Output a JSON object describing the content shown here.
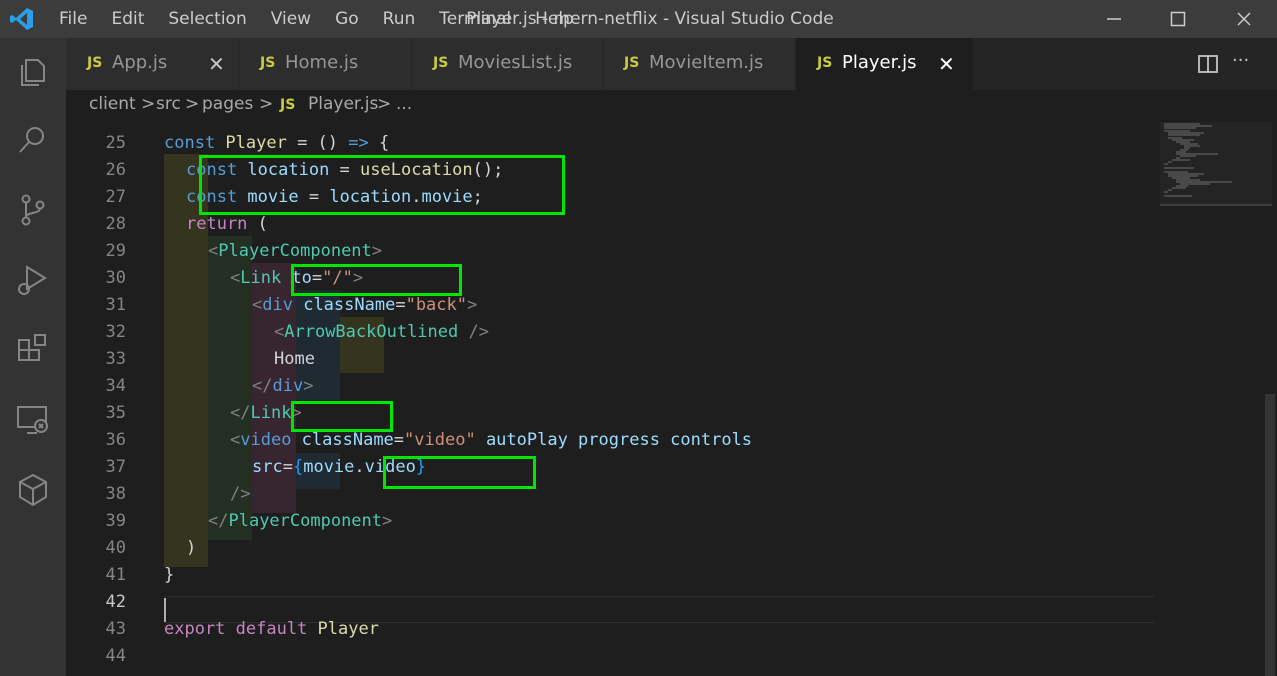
{
  "window": {
    "title": "Player.js - mern-netflix - Visual Studio Code",
    "menu": [
      "File",
      "Edit",
      "Selection",
      "View",
      "Go",
      "Run",
      "Terminal",
      "Help"
    ],
    "controls": {
      "minimize": "─",
      "maximize": "☐",
      "close": "✕"
    }
  },
  "activity_bar": [
    {
      "name": "explorer-icon"
    },
    {
      "name": "search-icon"
    },
    {
      "name": "source-control-icon"
    },
    {
      "name": "run-debug-icon"
    },
    {
      "name": "extensions-icon"
    },
    {
      "name": "remote-explorer-icon"
    },
    {
      "name": "docker-icon"
    }
  ],
  "tabs": [
    {
      "badge": "JS",
      "label": "App.js",
      "close": "✕",
      "active": false
    },
    {
      "badge": "JS",
      "label": "Home.js",
      "active": false
    },
    {
      "badge": "JS",
      "label": "MoviesList.js",
      "active": false
    },
    {
      "badge": "JS",
      "label": "MovieItem.js",
      "active": false
    },
    {
      "badge": "JS",
      "label": "Player.js",
      "close": "✕",
      "active": true
    }
  ],
  "tab_actions": {
    "more": "···"
  },
  "breadcrumb": {
    "items": [
      "client",
      "src",
      "pages",
      "Player.js",
      "..."
    ],
    "sep": ">",
    "badge": "JS"
  },
  "editor": {
    "line_numbers": [
      "25",
      "26",
      "27",
      "28",
      "29",
      "30",
      "31",
      "32",
      "33",
      "34",
      "35",
      "36",
      "37",
      "38",
      "39",
      "40",
      "41",
      "42",
      "43",
      "44"
    ],
    "current_line": "42",
    "lines": [
      [
        [
          "const ",
          "kw"
        ],
        [
          "Player",
          "fn"
        ],
        [
          " = () ",
          "op"
        ],
        [
          "=>",
          "arrow"
        ],
        [
          " {",
          "op"
        ]
      ],
      [
        [
          "const ",
          "kw"
        ],
        [
          "location",
          "var"
        ],
        [
          " = ",
          "op"
        ],
        [
          "useLocation",
          "fn"
        ],
        [
          "();",
          "op"
        ]
      ],
      [
        [
          "const ",
          "kw"
        ],
        [
          "movie",
          "var"
        ],
        [
          " = ",
          "op"
        ],
        [
          "location",
          "var"
        ],
        [
          ".",
          "op"
        ],
        [
          "movie",
          "var"
        ],
        [
          ";",
          "op"
        ]
      ],
      [
        [
          "return",
          "ctl"
        ],
        [
          " (",
          "op"
        ]
      ],
      [
        [
          "<",
          "punc"
        ],
        [
          "PlayerComponent",
          "tag"
        ],
        [
          ">",
          "punc"
        ]
      ],
      [
        [
          "<",
          "punc"
        ],
        [
          "Link ",
          "tag"
        ],
        [
          "to",
          "var"
        ],
        [
          "=",
          "op"
        ],
        [
          "\"/\"",
          "str"
        ],
        [
          ">",
          "punc"
        ]
      ],
      [
        [
          "<",
          "punc"
        ],
        [
          "div ",
          "kw"
        ],
        [
          "className",
          "var"
        ],
        [
          "=",
          "op"
        ],
        [
          "\"back\"",
          "str"
        ],
        [
          ">",
          "punc"
        ]
      ],
      [
        [
          "<",
          "punc"
        ],
        [
          "ArrowBackOutlined ",
          "tag"
        ],
        [
          "/>",
          "punc"
        ]
      ],
      [
        [
          "Home",
          "def"
        ]
      ],
      [
        [
          "</",
          "punc"
        ],
        [
          "div",
          "kw"
        ],
        [
          ">",
          "punc"
        ]
      ],
      [
        [
          "</",
          "punc"
        ],
        [
          "Link",
          "tag"
        ],
        [
          ">",
          "punc"
        ]
      ],
      [
        [
          "<",
          "punc"
        ],
        [
          "video ",
          "kw"
        ],
        [
          "className",
          "var"
        ],
        [
          "=",
          "op"
        ],
        [
          "\"video\"",
          "str"
        ],
        [
          " autoPlay progress controls",
          "var"
        ]
      ],
      [
        [
          "src",
          "var"
        ],
        [
          "=",
          "op"
        ],
        [
          "{",
          "br3"
        ],
        [
          "movie",
          "var"
        ],
        [
          ".",
          "op"
        ],
        [
          "video",
          "var"
        ],
        [
          "}",
          "br3"
        ]
      ],
      [
        [
          "/>",
          "punc"
        ]
      ],
      [
        [
          "</",
          "punc"
        ],
        [
          "PlayerComponent",
          "tag"
        ],
        [
          ">",
          "punc"
        ]
      ],
      [
        [
          ")",
          "op"
        ]
      ],
      [
        [
          "}",
          "op"
        ]
      ],
      [],
      [
        [
          "export ",
          "ctl"
        ],
        [
          "default ",
          "ctl"
        ],
        [
          "Player",
          "fn"
        ]
      ],
      []
    ]
  },
  "colors": {
    "keyword": "#569cd6",
    "function": "#dcdcaa",
    "variable": "#9cdcfe",
    "control": "#c586c0",
    "tag": "#4ec9b0",
    "string": "#ce9178",
    "punctuation": "#808080",
    "highlight_box": "#00e600"
  }
}
